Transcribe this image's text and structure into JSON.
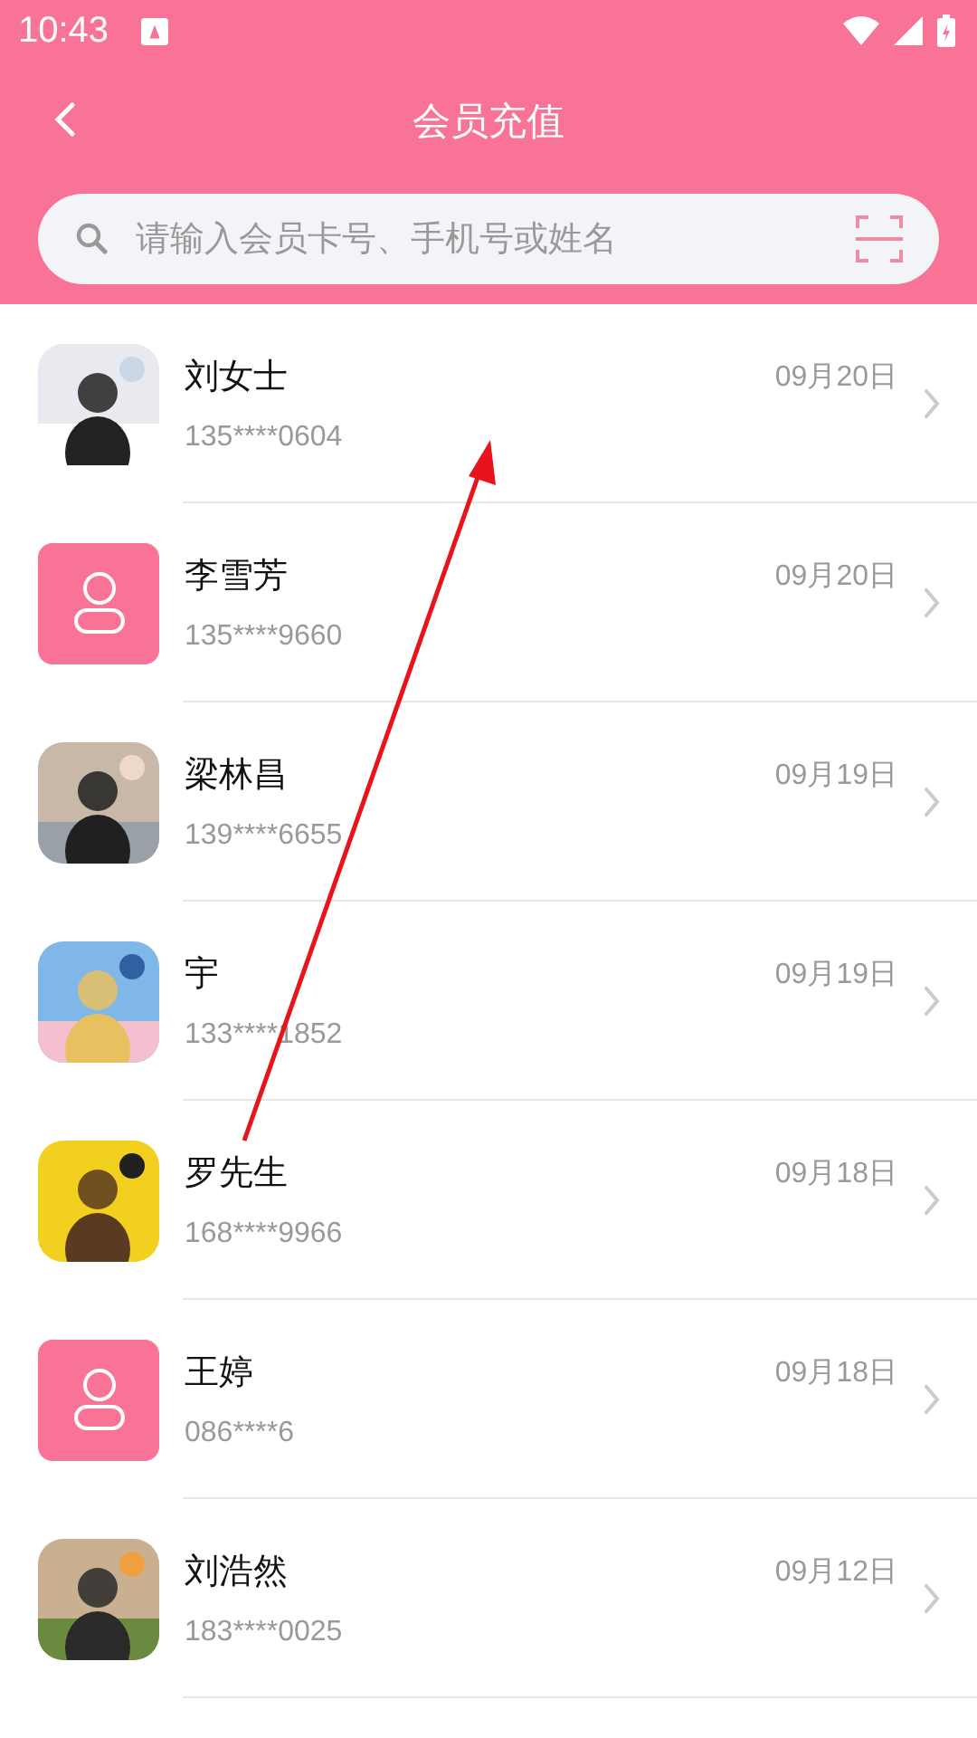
{
  "status_bar": {
    "time": "10:43"
  },
  "header": {
    "title": "会员充值"
  },
  "search": {
    "placeholder": "请输入会员卡号、手机号或姓名"
  },
  "members": [
    {
      "name": "刘女士",
      "phone": "135****0604",
      "date": "09月20日"
    },
    {
      "name": "李雪芳",
      "phone": "135****9660",
      "date": "09月20日",
      "avatar": {
        "kind": "default"
      }
    },
    {
      "name": "梁林昌",
      "phone": "139****6655",
      "date": "09月19日"
    },
    {
      "name": "宇",
      "phone": "133****1852",
      "date": "09月19日"
    },
    {
      "name": "罗先生",
      "phone": "168****9966",
      "date": "09月18日"
    },
    {
      "name": "王婷",
      "phone": "086****6",
      "date": "09月18日",
      "avatar": {
        "kind": "default"
      }
    },
    {
      "name": "刘浩然",
      "phone": "183****0025",
      "date": "09月12日"
    }
  ]
}
